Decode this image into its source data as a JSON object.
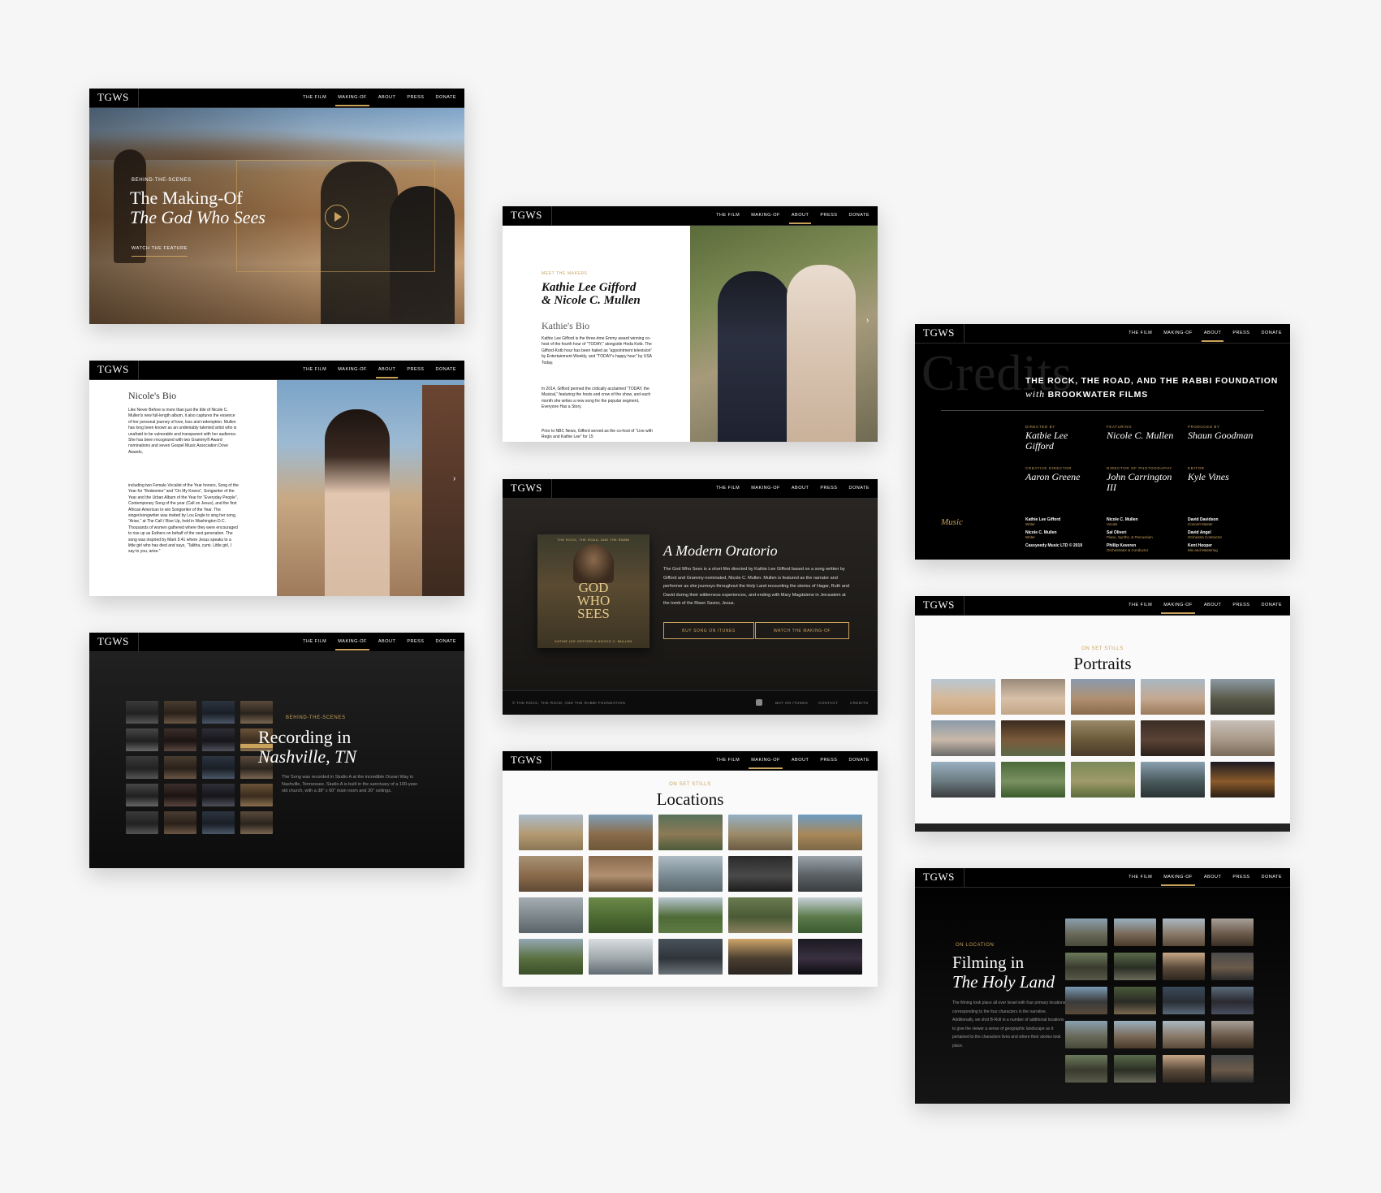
{
  "nav": {
    "logo": "TGWS",
    "items": [
      "THE FILM",
      "MAKING-OF",
      "ABOUT",
      "PRESS",
      "DONATE"
    ]
  },
  "card_making_of": {
    "eyebrow": "BEHIND-THE-SCENES",
    "title_line1": "The Making-Of",
    "title_line2": "The God Who Sees",
    "cta": "WATCH THE FEATURE"
  },
  "card_nicole": {
    "heading": "Nicole's Bio",
    "para1": "Like Never Before is more than just the title of Nicole C. Mullen's new full-length album, it also captures the essence of her personal journey of love, loss and redemption. Mullen has long been known as an undeniably talented artist who is unafraid to be vulnerable and transparent with her audience. She has been recognized with two Grammy® Award nominations and seven Gospel Music Association Dove Awards,",
    "para2": "including two Female Vocalist of the Year honors, Song of the Year for “Redeemer” and “On My Knees”, Songwriter of the Year and the Urban Album of the Year for “Everyday People”, Contemporary Song of the year (Call on Jesus), and the first African American to win Songwriter of the Year. The singer/songwriter was invited by Lou Engle to sing her song, “Arise,” at The Call / Rise Up, held in Washington D.C. Thousands of women gathered where they were encouraged to rise up as Esthers on behalf of the next generation. The song was inspired by Mark 5:41 where Jesus speaks to a little girl who has died and says, “Talitha, cumi. Little girl, I say to you, arise.”"
  },
  "card_nashville": {
    "eyebrow": "BEHIND-THE-SCENES",
    "title_line1": "Recording in",
    "title_line2": "Nashville, TN",
    "body": "The Song was recorded in Studio A at the incredible Ocean Way in Nashville, Tennessee. Studio A is built in the sanctuary of a 100-year-old church, with a 38\" x 60\" main room and 30\" ceilings."
  },
  "card_makers": {
    "eyebrow": "MEET THE MAKERS",
    "title_line1": "Kathie Lee Gifford",
    "title_line2": "& Nicole C. Mullen",
    "subheading": "Kathie's Bio",
    "para1": "Kathie Lee Gifford is the three-time Emmy award winning co-host of the fourth hour of “TODAY,” alongside Hoda Kotb. The Gifford-Kotb hour has been hailed as “appointment television” by Entertainment Weekly, and “TODAY’s happy hour” by USA Today.",
    "para2": "In 2014, Gifford penned the critically acclaimed “TODAY, the Musical,” featuring the hosts and crew of the show, and each month she writes a new song for the popular segment, Everyone Has a Story.",
    "para3": "Prior to NBC News, Gifford served as the co-host of “Live with Regis and Kathie Lee” for 15"
  },
  "card_oratorio": {
    "album_title": "GOD WHO SEES",
    "album_top": "THE ROCK, THE ROAD, AND THE RABBI",
    "album_bottom": "KATHIE LEE GIFFORD & NICOLE C. MULLEN",
    "title": "A Modern Oratorio",
    "body": "The God Who Sees is a short film directed by Kathie Lee Gifford based on a song written by Gifford and Grammy-nominated, Nicole C. Mullen. Mullen is featured as the narrator and performer as she journeys throughout the Holy Land recounting the stories of Hagar, Ruth and David during their wilderness experiences, and ending with Mary Magdalene in Jerusalem at the tomb of the Risen Savior, Jesus.",
    "btn1": "BUY SONG ON ITUNES",
    "btn2": "WATCH THE MAKING-OF",
    "footer_left": "© THE ROCK, THE ROAD, AND THE RABBI FOUNDATION",
    "footer_links": [
      "BUY ON ITUNES",
      "CONTACT",
      "CREDITS"
    ]
  },
  "card_locations": {
    "eyebrow": "ON SET STILLS",
    "title": "Locations"
  },
  "card_credits": {
    "bg_word": "Credits",
    "heading_line1": "THE ROCK, THE ROAD, AND THE RABBI FOUNDATION",
    "heading_with": "with",
    "heading_line2": "BROOKWATER FILMS",
    "roles": [
      {
        "label": "DIRECTED BY",
        "name": "Katbie Lee Gifford"
      },
      {
        "label": "FEATURING",
        "name": "Nicole C. Mullen"
      },
      {
        "label": "PRODUCED BY",
        "name": "Shaun Goodman"
      },
      {
        "label": "CREATIVE DIRECTOR",
        "name": "Aaron Greene"
      },
      {
        "label": "DIRECTOR OF PHOTOGRAPHY",
        "name": "John Carrington III"
      },
      {
        "label": "EDITOR",
        "name": "Kyle Vines"
      }
    ],
    "music_label": "Music",
    "music": [
      [
        {
          "n": "Kathie Lee Gifford",
          "r": "Writer"
        },
        {
          "n": "Nicole C. Mullen",
          "r": "Writer"
        },
        {
          "n": "Cassyeedy Music LTD © 2019",
          "r": ""
        }
      ],
      [
        {
          "n": "Nicole C. Mullen",
          "r": "Vocals"
        },
        {
          "n": "Sal Oliveri",
          "r": "Piano, Synths, & Percussion"
        },
        {
          "n": "Phillip Keveren",
          "r": "Orchestrator & Conductor"
        }
      ],
      [
        {
          "n": "David Davidson",
          "r": "Concert Master"
        },
        {
          "n": "David Angel",
          "r": "Orchestra Contractor"
        },
        {
          "n": "Kent Hooper",
          "r": "Mix and Mastering"
        }
      ]
    ]
  },
  "card_portraits": {
    "eyebrow": "ON SET STILLS",
    "title": "Portraits"
  },
  "card_filming": {
    "eyebrow": "ON LOCATION",
    "title_line1": "Filming in",
    "title_line2": "The Holy Land",
    "body": "The filming took place all over Israel with four primary locations corresponding to the four characters in the narrative. Additionally, we shot B-Roll in a number of additional locations to give the viewer a sense of geographic landscape as it pertained to the characters lives and where their stories took place."
  },
  "colors": {
    "accent_gold": "#c9a25c",
    "page_bg": "#f6f6f6",
    "nav_bg": "#000000"
  }
}
